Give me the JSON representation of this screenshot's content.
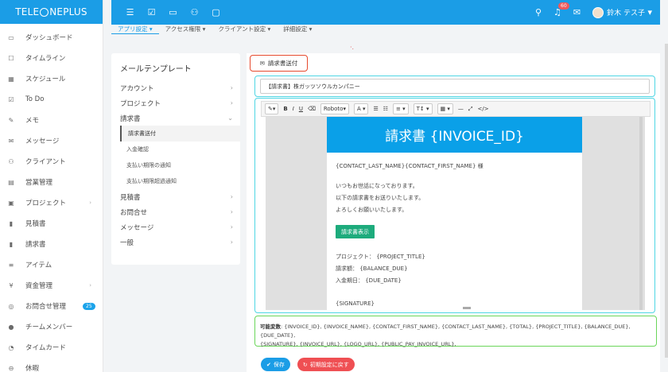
{
  "app": {
    "logo_left": "TELE",
    "logo_right": "NEPLUS"
  },
  "topbar": {
    "notification_count": "60",
    "user_name": "鈴木 テス子"
  },
  "sidebar": {
    "items": [
      {
        "label": "ダッシュボード",
        "icon": "monitor-icon",
        "glyph": "▭"
      },
      {
        "label": "タイムライン",
        "icon": "timeline-icon",
        "glyph": "☐"
      },
      {
        "label": "スケジュール",
        "icon": "calendar-icon",
        "glyph": "▦"
      },
      {
        "label": "To Do",
        "icon": "checkbox-icon",
        "glyph": "☑"
      },
      {
        "label": "メモ",
        "icon": "memo-icon",
        "glyph": "✎"
      },
      {
        "label": "メッセージ",
        "icon": "envelope-icon",
        "glyph": "✉"
      },
      {
        "label": "クライアント",
        "icon": "users-icon",
        "glyph": "⚇"
      },
      {
        "label": "営業管理",
        "icon": "briefcase-icon",
        "glyph": "▤"
      },
      {
        "label": "プロジェクト",
        "icon": "folder-icon",
        "glyph": "▣"
      },
      {
        "label": "見積書",
        "icon": "file-icon",
        "glyph": "▮"
      },
      {
        "label": "請求書",
        "icon": "invoice-icon",
        "glyph": "▮"
      },
      {
        "label": "アイテム",
        "icon": "list-icon",
        "glyph": "≡"
      },
      {
        "label": "資金管理",
        "icon": "yen-icon",
        "glyph": "¥"
      },
      {
        "label": "お問合せ管理",
        "icon": "support-icon",
        "glyph": "◎"
      },
      {
        "label": "チームメンバー",
        "icon": "person-icon",
        "glyph": "●"
      },
      {
        "label": "タイムカード",
        "icon": "clock-icon",
        "glyph": "◔"
      },
      {
        "label": "休暇",
        "icon": "leave-icon",
        "glyph": "⊖"
      }
    ],
    "inquiry_badge": "25"
  },
  "tabs": [
    "アプリ設定",
    "アクセス権限",
    "クライアント設定",
    "詳細設定"
  ],
  "left_panel": {
    "title": "メールテンプレート",
    "groups_top": [
      "アカウント",
      "プロジェクト"
    ],
    "open_group": "請求書",
    "sub_items": [
      "請求書送付",
      "入金確認",
      "支払い期限の通知",
      "支払い期限超過通知"
    ],
    "groups_bottom": [
      "見積書",
      "お問合せ",
      "メッセージ",
      "一般"
    ]
  },
  "editor": {
    "template_tab": "請求書送付",
    "subject": "【請求書】株ガッツソウルカンパニー",
    "font_name": "Roboto",
    "banner": "請求書 {INVOICE_ID}",
    "greeting": "{CONTACT_LAST_NAME}{CONTACT_FIRST_NAME} 様",
    "line1": "いつもお世話になっております。",
    "line2": "以下の請求書をお送りいたします。",
    "line3": "よろしくお願いいたします。",
    "show_button": "請求書表示",
    "project_line": "プロジェクト： {PROJECT_TITLE}",
    "amount_line": "請求額： {BALANCE_DUE}",
    "due_line": "入金期日： {DUE_DATE}",
    "signature": "{SIGNATURE}"
  },
  "variables": {
    "label": "可能変数",
    "line1": ": {INVOICE_ID}, {INVOICE_NAME}, {CONTACT_FIRST_NAME}, {CONTACT_LAST_NAME}, {TOTAL}, {PROJECT_TITLE}, {BALANCE_DUE}, {DUE_DATE},",
    "line2": "{SIGNATURE}, {INVOICE_URL}, {LOGO_URL}, {PUBLIC_PAY_INVOICE_URL},"
  },
  "buttons": {
    "save": "保存",
    "reset": "初期設定に戻す"
  },
  "colors": {
    "primary": "#1b9de6",
    "success": "#1dab7c",
    "danger": "#ef4f53",
    "highlight_cyan": "#4fd6e4",
    "highlight_green": "#6ad65a",
    "highlight_red": "#e64a2e"
  }
}
